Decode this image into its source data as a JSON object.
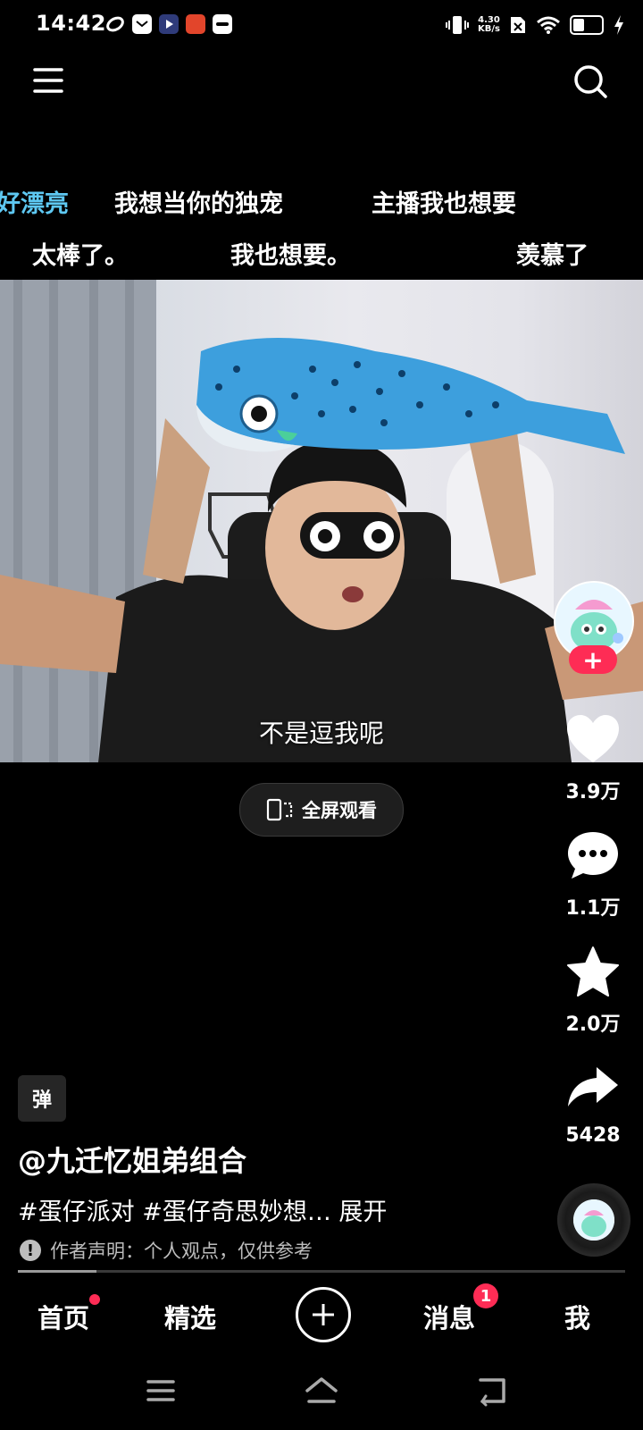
{
  "status_bar": {
    "time": "14:42",
    "net_speed_value": "4.30",
    "net_speed_unit": "KB/s",
    "battery_level": 0.45
  },
  "danmaku": {
    "row1": [
      "好漂亮",
      "我想当你的独宠",
      "主播我也想要"
    ],
    "row2": [
      "太棒了。",
      "我也想要。",
      "羡慕了"
    ]
  },
  "video": {
    "subtitle": "不是逗我呢",
    "fullscreen_label": "全屏观看"
  },
  "actions": {
    "likes": "3.9万",
    "comments": "1.1万",
    "favorites": "2.0万",
    "shares": "5428"
  },
  "post": {
    "tag": "弹",
    "author": "@九迁忆姐弟组合",
    "description": "#蛋仔派对 #蛋仔奇思妙想… 展开",
    "notice": "作者声明：个人观点，仅供参考",
    "progress": 0.13
  },
  "bottom_nav": {
    "home": "首页",
    "featured": "精选",
    "messages": "消息",
    "messages_badge": "1",
    "me": "我"
  },
  "colors": {
    "accent": "#fe2c55",
    "danmaku_highlight": "#5ec8f2"
  }
}
